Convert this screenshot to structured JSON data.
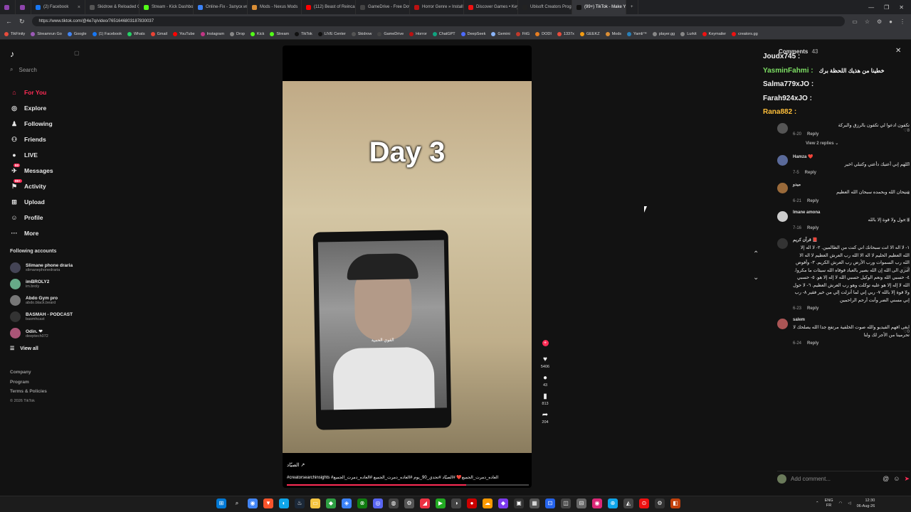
{
  "browser": {
    "tabs": [
      {
        "title": "",
        "color": "#8e44ad"
      },
      {
        "title": "",
        "color": "#8e44ad"
      },
      {
        "title": "(2) Facebook",
        "color": "#1877f2"
      },
      {
        "title": "Skidrow & Reloaded Game",
        "color": "#555"
      },
      {
        "title": "Stream - Kick Dashboard",
        "color": "#53fc18"
      },
      {
        "title": "Online-Fix - Запуск игр по",
        "color": "#3b82f6"
      },
      {
        "title": "Mods - Nexus Mods",
        "color": "#da8e35"
      },
      {
        "title": "(112) Beast of Reincarnatio",
        "color": "#ff0000"
      },
      {
        "title": "GameDrive - Free Downlo",
        "color": "#444"
      },
      {
        "title": "Horror Genre » Install Guid",
        "color": "#b11"
      },
      {
        "title": "Discover Games • Keymail",
        "color": "#e11"
      },
      {
        "title": "Ubisoft Creators Program",
        "color": "#222"
      },
      {
        "title": "(99+) TikTok - Make Yo",
        "color": "#111"
      }
    ],
    "url": "https://www.tiktok.com/@4e7q/video/7651646803187830037",
    "window_controls": [
      "—",
      "❐",
      "✕"
    ],
    "bookmarks": [
      {
        "label": "TikFinity",
        "color": "#e74c3c"
      },
      {
        "label": "Streamrun Go",
        "color": "#9b59b6"
      },
      {
        "label": "Google",
        "color": "#4285f4"
      },
      {
        "label": "(1) Facebook",
        "color": "#1877f2"
      },
      {
        "label": "Whats",
        "color": "#25d366"
      },
      {
        "label": "Gmail",
        "color": "#ea4335"
      },
      {
        "label": "YouTube",
        "color": "#ff0000"
      },
      {
        "label": "Instagram",
        "color": "#c13584"
      },
      {
        "label": "Drop",
        "color": "#888"
      },
      {
        "label": "Kick",
        "color": "#53fc18"
      },
      {
        "label": "Stream",
        "color": "#53fc18"
      },
      {
        "label": "TikTok",
        "color": "#111"
      },
      {
        "label": "LIVE Center",
        "color": "#111"
      },
      {
        "label": "Skidrow",
        "color": "#555"
      },
      {
        "label": "GameDrive",
        "color": "#444"
      },
      {
        "label": "Horror",
        "color": "#b11"
      },
      {
        "label": "ChatGPT",
        "color": "#10a37f"
      },
      {
        "label": "DeepSeek",
        "color": "#4d6bfe"
      },
      {
        "label": "Gemini",
        "color": "#8ab4f8"
      },
      {
        "label": "FitG",
        "color": "#c0392b"
      },
      {
        "label": "DODI",
        "color": "#e67e22"
      },
      {
        "label": "1337x",
        "color": "#e74c3c"
      },
      {
        "label": "GEEKZ",
        "color": "#f39c12"
      },
      {
        "label": "Mods",
        "color": "#da8e35"
      },
      {
        "label": "Yamli™",
        "color": "#2980b9"
      },
      {
        "label": "player.gg",
        "color": "#888"
      },
      {
        "label": "Lurkit",
        "color": "#888"
      },
      {
        "label": "Keymailer",
        "color": "#e11"
      },
      {
        "label": "creators.gg",
        "color": "#e11"
      }
    ]
  },
  "sidebar": {
    "search_placeholder": "Search",
    "nav": [
      {
        "label": "For You",
        "icon": "home-icon",
        "glyph": "⌂",
        "active": true,
        "badge": ""
      },
      {
        "label": "Explore",
        "icon": "compass-icon",
        "glyph": "◎",
        "active": false,
        "badge": ""
      },
      {
        "label": "Following",
        "icon": "following-icon",
        "glyph": "♟",
        "active": false,
        "badge": ""
      },
      {
        "label": "Friends",
        "icon": "friends-icon",
        "glyph": "⚇",
        "active": false,
        "badge": ""
      },
      {
        "label": "LIVE",
        "icon": "live-icon",
        "glyph": "●",
        "active": false,
        "badge": ""
      },
      {
        "label": "Messages",
        "icon": "messages-icon",
        "glyph": "✈",
        "active": false,
        "badge": "93"
      },
      {
        "label": "Activity",
        "icon": "activity-icon",
        "glyph": "⚑",
        "active": false,
        "badge": "99+"
      },
      {
        "label": "Upload",
        "icon": "upload-icon",
        "glyph": "⊞",
        "active": false,
        "badge": ""
      },
      {
        "label": "Profile",
        "icon": "profile-icon",
        "glyph": "☺",
        "active": false,
        "badge": ""
      },
      {
        "label": "More",
        "icon": "more-icon",
        "glyph": "···",
        "active": false,
        "badge": ""
      }
    ],
    "following_title": "Following accounts",
    "following": [
      {
        "name": "Slimane phone draria",
        "handle": "slimanephonedraria",
        "color": "#445"
      },
      {
        "name": "imBROLY2",
        "handle": "im.broly",
        "color": "#6a8"
      },
      {
        "name": "Abdo Gym pro",
        "handle": "abdo.black.beard",
        "color": "#777"
      },
      {
        "name": "BASMAH - PODCAST",
        "handle": "basmhcast",
        "color": "#333"
      },
      {
        "name": "Odin. ❤",
        "handle": "deeptech072",
        "color": "#a57"
      }
    ],
    "view_all": "View all",
    "footer": [
      "Company",
      "Program",
      "Terms & Policies"
    ],
    "copyright": "© 2026 TikTok"
  },
  "video": {
    "overlay_title": "Day 3",
    "subtitle": "القوي الحمية",
    "caption": "الصيّاد ↗",
    "hashtags": "#creatorsearchinsights #العاده_دمرت_الجميع❤️ #الصيّاد #تحدي_90_يوم #العاده_دمرت_الجميع #العاده_دمرت_الجميع",
    "progress": 0.74
  },
  "actions": {
    "likes": "5406",
    "comments": "43",
    "saves": "813",
    "shares": "204"
  },
  "comments": {
    "header": "Comments",
    "count": "43",
    "live_overlay": [
      {
        "name": "Joudx745 :",
        "text": "",
        "style": ""
      },
      {
        "name": "YasminFahmi :",
        "text": "خطينا من هذيك اللحظة برك",
        "style": "green"
      },
      {
        "name": "Salma779xJO :",
        "text": "",
        "style": ""
      },
      {
        "name": "Farah924xJO :",
        "text": "",
        "style": ""
      },
      {
        "name": "Rana882 :",
        "text": "",
        "style": "gold"
      }
    ],
    "items": [
      {
        "user": "",
        "text": "تكفون ادعوا لي تكفون بالرزق والبركة",
        "date": "6-20",
        "likes": "8",
        "color": "#555"
      },
      {
        "user": "Hamza ❤️",
        "text": "اللهم إني أعتيك دأعتي وكتبلي اخير",
        "date": "7-5",
        "likes": "0",
        "color": "#5a6a9a"
      },
      {
        "user": "ميدو",
        "text": "سبحان الله وبحمده سبحان الله العظيم",
        "date": "6-21",
        "likes": "6",
        "color": "#9a6a3a"
      },
      {
        "user": "Imane amona",
        "text": "لا حول ولا قوة إلا بالله",
        "date": "7-16",
        "likes": "0",
        "color": "#ccc"
      },
      {
        "user": "قرآن كريم 📕",
        "text": "١- لا اله الا انت سبحانك اني كنت من الظالمين. ٢- لا اله إلا الله العظيم الحليم لا اله الا الله رب العرش العظيم لا اله الا الله رب السموات ورب الأرض رب العرش الكريم. ٣- وأفوض امري الى الله إن الله بصير بالعباد فوقاه الله سيئات ما مكروا. ٤- حسبي الله ونعم الوكيل حسبي الله لا إله إلا هو. ٥- حسبي الله لا إله إلا هو عليه توكلت وهو رب العرش العظيم. ٦- لا حول ولا قوة إلا بالله ٧- ربي إني لما أنزلت إلي من خير فقير ٨- رب إني مسني الضر وأنت أرحم الراحمين",
        "date": "6-23",
        "likes": "0",
        "color": "#333"
      },
      {
        "user": "salem",
        "text": "ابغى افهم الفيديو والله صوت الخلفية مرتفع جدا الله يصلحك لا تحرمينا من الأجر لك ولنا",
        "date": "6-24",
        "likes": "0",
        "color": "#a55"
      }
    ],
    "view_replies": "View 2 replies ⌄",
    "reply_label": "Reply",
    "add_placeholder": "Add comment..."
  },
  "taskbar": {
    "apps": [
      {
        "icon": "windows-icon",
        "color": "#0078d4",
        "glyph": "⊞"
      },
      {
        "icon": "search-icon",
        "color": "#1c1c1c",
        "glyph": "⌕"
      },
      {
        "icon": "chrome-icon",
        "color": "#4285f4",
        "glyph": "◉"
      },
      {
        "icon": "brave-icon",
        "color": "#fb542b",
        "glyph": "▼"
      },
      {
        "icon": "edge-icon",
        "color": "#0ea5e9",
        "glyph": "◐"
      },
      {
        "icon": "steam-icon",
        "color": "#1b2838",
        "glyph": "♨"
      },
      {
        "icon": "folder-icon",
        "color": "#f5c542",
        "glyph": "▭"
      },
      {
        "icon": "app-icon",
        "color": "#2ea043",
        "glyph": "◆"
      },
      {
        "icon": "app-icon",
        "color": "#3b82f6",
        "glyph": "◈"
      },
      {
        "icon": "xbox-icon",
        "color": "#107c10",
        "glyph": "⊗"
      },
      {
        "icon": "discord-icon",
        "color": "#5865f2",
        "glyph": "◎"
      },
      {
        "icon": "app-icon",
        "color": "#444",
        "glyph": "◍"
      },
      {
        "icon": "app-icon",
        "color": "#555",
        "glyph": "⚙"
      },
      {
        "icon": "app-icon",
        "color": "#e34",
        "glyph": "◢"
      },
      {
        "icon": "play-icon",
        "color": "#2a2",
        "glyph": "▶"
      },
      {
        "icon": "app-icon",
        "color": "#444",
        "glyph": "◑"
      },
      {
        "icon": "app-icon",
        "color": "#c00",
        "glyph": "●"
      },
      {
        "icon": "cloud-icon",
        "color": "#f90",
        "glyph": "☁"
      },
      {
        "icon": "app-icon",
        "color": "#7c3aed",
        "glyph": "◆"
      },
      {
        "icon": "app-icon",
        "color": "#333",
        "glyph": "▣"
      },
      {
        "icon": "app-icon",
        "color": "#555",
        "glyph": "▦"
      },
      {
        "icon": "app-icon",
        "color": "#2563eb",
        "glyph": "⊡"
      },
      {
        "icon": "app-icon",
        "color": "#444",
        "glyph": "◫"
      },
      {
        "icon": "app-icon",
        "color": "#666",
        "glyph": "⊟"
      },
      {
        "icon": "app-icon",
        "color": "#db2777",
        "glyph": "◉"
      },
      {
        "icon": "app-icon",
        "color": "#0ea5e9",
        "glyph": "⊕"
      },
      {
        "icon": "app-icon",
        "color": "#444",
        "glyph": "◭"
      },
      {
        "icon": "app-icon",
        "color": "#e11",
        "glyph": "⊙"
      },
      {
        "icon": "app-icon",
        "color": "#333",
        "glyph": "⚙"
      },
      {
        "icon": "app-icon",
        "color": "#c2410c",
        "glyph": "◧"
      }
    ],
    "lang_top": "ENG",
    "lang_bottom": "FR",
    "time": "12:30",
    "date": "06-Aug-26"
  }
}
